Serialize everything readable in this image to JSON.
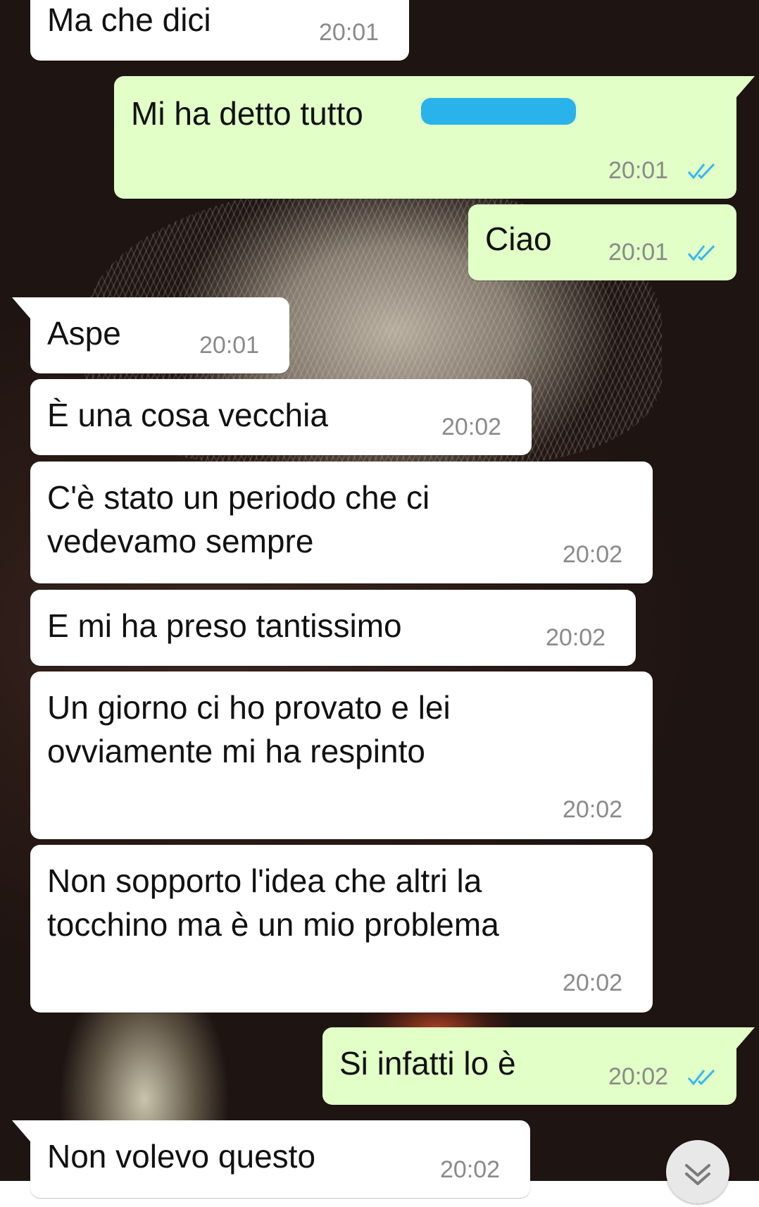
{
  "colors": {
    "outgoing_bubble": "#e1ffc7",
    "incoming_bubble": "#ffffff",
    "read_ticks": "#34b7f1",
    "timestamp": "#8a8a8a",
    "redaction": "#2ab3ea"
  },
  "messages": [
    {
      "direction": "incoming",
      "text": "Ma che dici",
      "time": "20:01"
    },
    {
      "direction": "outgoing",
      "text": "Mi ha detto tutto",
      "time": "20:01",
      "status": "read",
      "redacted_suffix": true
    },
    {
      "direction": "outgoing",
      "text": "Ciao",
      "time": "20:01",
      "status": "read"
    },
    {
      "direction": "incoming",
      "text": "Aspe",
      "time": "20:01"
    },
    {
      "direction": "incoming",
      "text": "È una cosa vecchia",
      "time": "20:02"
    },
    {
      "direction": "incoming",
      "text": "C'è stato un periodo che ci\nvedevamo sempre",
      "time": "20:02"
    },
    {
      "direction": "incoming",
      "text": "E mi ha preso tantissimo",
      "time": "20:02"
    },
    {
      "direction": "incoming",
      "text": "Un giorno ci ho provato e lei\novviamente mi ha respinto",
      "time": "20:02"
    },
    {
      "direction": "incoming",
      "text": "Non sopporto l'idea che altri la\ntocchino ma è un mio problema",
      "time": "20:02"
    },
    {
      "direction": "outgoing",
      "text": "Si infatti lo è",
      "time": "20:02",
      "status": "read"
    },
    {
      "direction": "incoming",
      "text": "Non volevo questo",
      "time": "20:02"
    }
  ],
  "icons": {
    "read_receipt": "double-check-icon",
    "scroll_down": "chevron-down-icon"
  }
}
